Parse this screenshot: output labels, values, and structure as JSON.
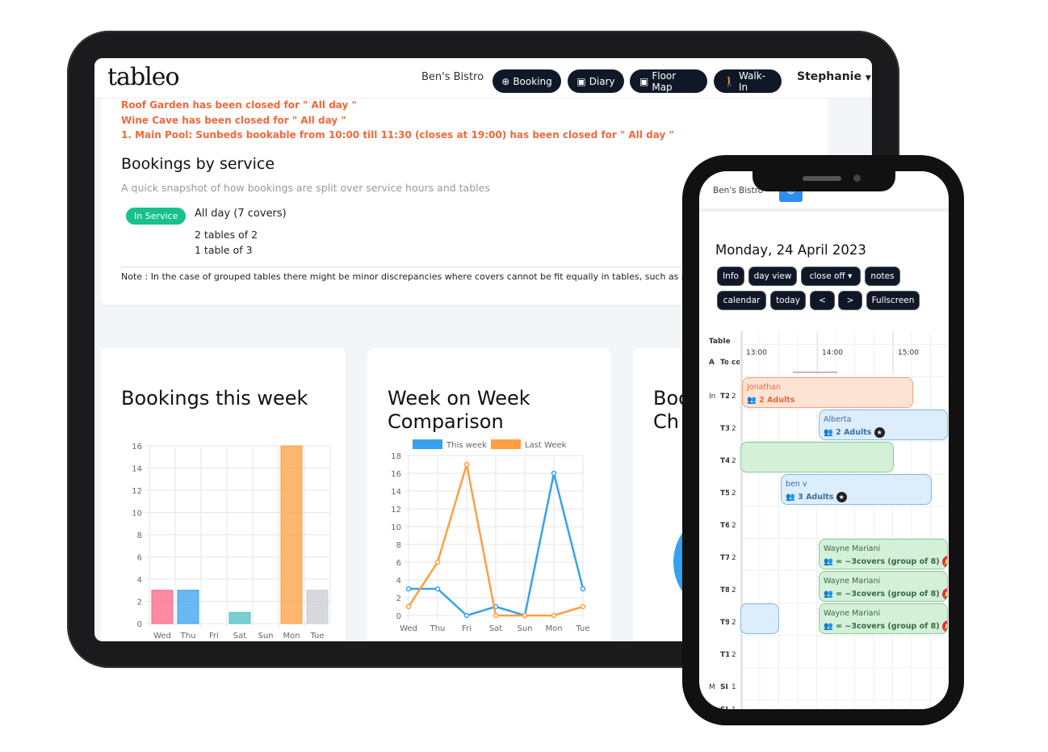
{
  "app": {
    "logo": "tableo",
    "restaurant": "Ben's Bistro",
    "user": "Stephanie",
    "nav": [
      {
        "label": "Booking",
        "icon": "plus-circle-icon"
      },
      {
        "label": "Diary",
        "icon": "calendar-icon"
      },
      {
        "label": "Floor Map",
        "icon": "calendar-icon"
      },
      {
        "label": "Walk-In",
        "icon": "walking-icon"
      }
    ]
  },
  "alerts": [
    "Roof Garden has been closed for \" All day \"",
    "Wine Cave has been closed for \" All day \"",
    "1. Main Pool: Sunbeds bookable from 10:00 till 11:30 (closes at 19:00) has been closed for \" All day \""
  ],
  "service": {
    "title": "Bookings by service",
    "subtitle": "A quick snapshot of how bookings are split over service hours and tables",
    "badge": "In Service",
    "period": "All day (7 covers)",
    "tables": [
      "2 tables of 2",
      "1 table of 3"
    ],
    "note": "Note : In the case of grouped tables there might be minor discrepancies where covers cannot be fit equally in tables, such as splitt"
  },
  "cards": {
    "third_title": "Boo\nCh"
  },
  "colors": {
    "accent": "#101828",
    "alert": "#f0693a",
    "badge": "#18c08a",
    "this_week": "#36a2eb",
    "last_week": "#ff9f40"
  },
  "chart_data": [
    {
      "type": "bar",
      "title": "Bookings this week",
      "categories": [
        "Wed",
        "Thu",
        "Fri",
        "Sat",
        "Sun",
        "Mon",
        "Tue"
      ],
      "values": [
        3,
        3,
        0,
        1,
        0,
        16,
        3
      ],
      "colors": [
        "#ff6384",
        "#36a2eb",
        "#ffce56",
        "#4bc0c0",
        "#9966ff",
        "#ff9f40",
        "#c9cbcf"
      ],
      "ylim": [
        0,
        16
      ],
      "yticks": [
        0,
        2,
        4,
        6,
        8,
        10,
        12,
        14,
        16
      ],
      "grid": true
    },
    {
      "type": "line",
      "title": "Week on Week Comparison",
      "categories": [
        "Wed",
        "Thu",
        "Fri",
        "Sat",
        "Sun",
        "Mon",
        "Tue"
      ],
      "series": [
        {
          "name": "This week",
          "values": [
            3,
            3,
            0,
            1,
            0,
            16,
            3
          ],
          "color": "#36a2eb"
        },
        {
          "name": "Last Week",
          "values": [
            1,
            6,
            17,
            0,
            0,
            0,
            1
          ],
          "color": "#ff9f40"
        }
      ],
      "ylim": [
        0,
        18
      ],
      "yticks": [
        0,
        2,
        4,
        6,
        8,
        10,
        12,
        14,
        16,
        18
      ],
      "grid": true,
      "legend": "top"
    }
  ],
  "phone": {
    "restaurant": "Ben's Bistro",
    "date": "Monday, 24 April 2023",
    "buttons_row1": [
      "Info",
      "day view",
      "close off",
      "notes"
    ],
    "buttons_row2": [
      "calendar",
      "today",
      "<",
      ">",
      "Fullscreen"
    ],
    "table_header": "Table",
    "sub_headers": [
      "A",
      "To",
      "co"
    ],
    "times": [
      "13:00",
      "14:00",
      "15:00"
    ],
    "rows": [
      {
        "a": "In",
        "t": "T2",
        "c": "2"
      },
      {
        "a": "",
        "t": "T3",
        "c": "2"
      },
      {
        "a": "",
        "t": "T4",
        "c": "2"
      },
      {
        "a": "",
        "t": "T5",
        "c": "2"
      },
      {
        "a": "",
        "t": "T6",
        "c": "2"
      },
      {
        "a": "",
        "t": "T7",
        "c": "2"
      },
      {
        "a": "",
        "t": "T8",
        "c": "2"
      },
      {
        "a": "",
        "t": "T9",
        "c": "2"
      },
      {
        "a": "",
        "t": "T1",
        "c": "2"
      },
      {
        "a": "M",
        "t": "SI",
        "c": "1"
      },
      {
        "a": "",
        "t": "SI",
        "c": "1"
      }
    ],
    "bookings": [
      {
        "name": "Jonathan",
        "detail": "2 Adults"
      },
      {
        "name": "Alberta",
        "detail": "2 Adults"
      },
      {
        "name": "ben v",
        "detail": "3 Adults"
      },
      {
        "name": "Wayne Mariani",
        "detail": "∞ ~3covers (group of 8)"
      },
      {
        "name": "Wayne Mariani",
        "detail": "∞ ~3covers (group of 8)"
      },
      {
        "name": "Wayne Mariani",
        "detail": "∞ ~3covers (group of 8)"
      }
    ]
  }
}
